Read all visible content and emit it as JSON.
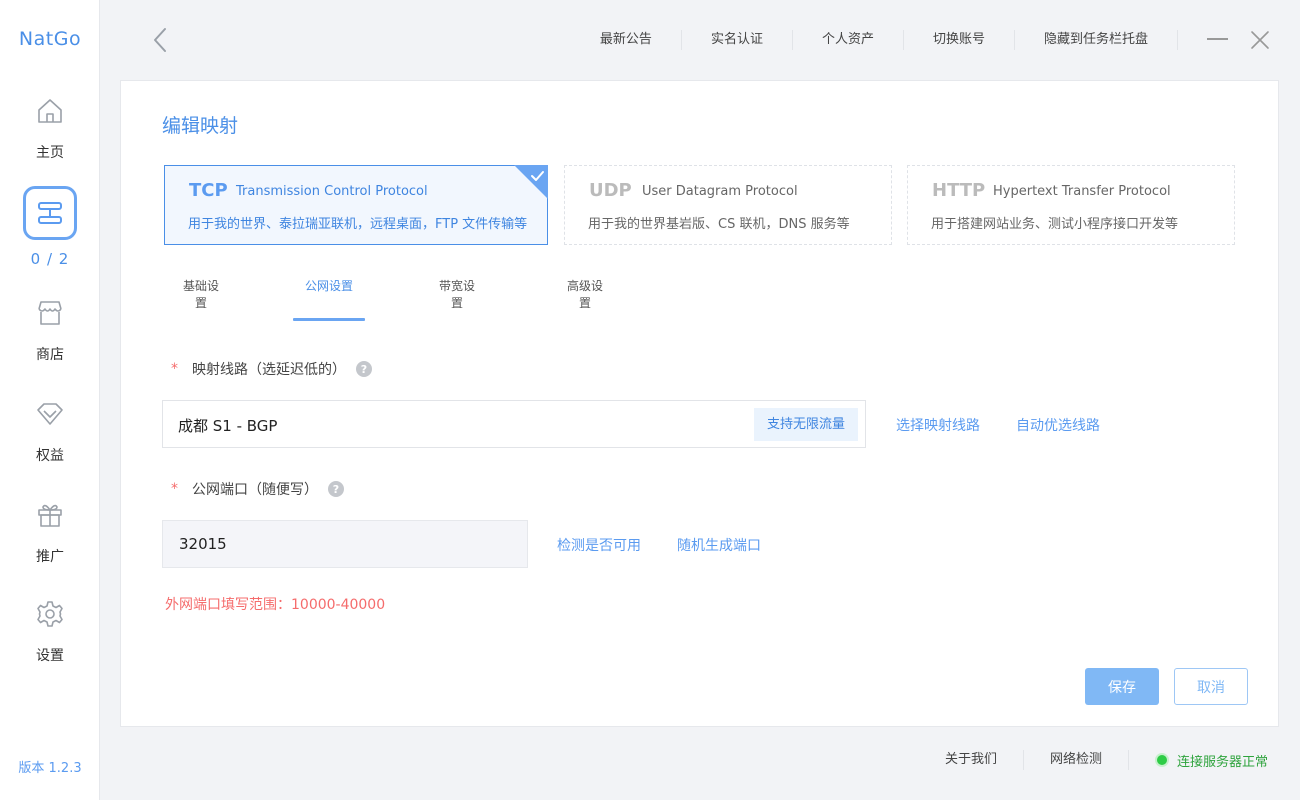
{
  "app": {
    "brand": "NatGo",
    "version": "版本 1.2.3"
  },
  "sidebar": {
    "items": [
      {
        "label": "主页",
        "icon": "home-icon"
      },
      {
        "label": "0 / 2",
        "icon": "mapping-icon",
        "active": true
      },
      {
        "label": "商店",
        "icon": "store-icon"
      },
      {
        "label": "权益",
        "icon": "diamond-icon"
      },
      {
        "label": "推广",
        "icon": "gift-icon"
      },
      {
        "label": "设置",
        "icon": "gear-icon"
      }
    ]
  },
  "topnav": {
    "items": [
      "最新公告",
      "实名认证",
      "个人资产",
      "切换账号",
      "隐藏到任务栏托盘"
    ]
  },
  "page": {
    "title": "编辑映射"
  },
  "protocols": [
    {
      "name": "TCP",
      "full": "Transmission Control Protocol",
      "desc": "用于我的世界、泰拉瑞亚联机，远程桌面，FTP 文件传输等",
      "selected": true
    },
    {
      "name": "UDP",
      "full": "User Datagram Protocol",
      "desc": "用于我的世界基岩版、CS 联机，DNS 服务等",
      "selected": false
    },
    {
      "name": "HTTP",
      "full": "Hypertext Transfer Protocol",
      "desc": "用于搭建网站业务、测试小程序接口开发等",
      "selected": false
    }
  ],
  "tabs": [
    {
      "label": "基础设置"
    },
    {
      "label": "公网设置",
      "active": true
    },
    {
      "label": "带宽设置"
    },
    {
      "label": "高级设置"
    }
  ],
  "route": {
    "required_mark": "*",
    "label": "映射线路（选延迟低的）",
    "help": "?",
    "value": "成都 S1 - BGP",
    "tag": "支持无限流量",
    "select_link": "选择映射线路",
    "auto_link": "自动优选线路"
  },
  "port": {
    "required_mark": "*",
    "label": "公网端口（随便写）",
    "help": "?",
    "value": "32015",
    "check_link": "检测是否可用",
    "random_link": "随机生成端口",
    "range_hint": "外网端口填写范围：10000-40000"
  },
  "actions": {
    "save": "保存",
    "cancel": "取消"
  },
  "footer": {
    "about": "关于我们",
    "network_check": "网络检测",
    "status": "连接服务器正常",
    "status_color": "#2ecc46"
  },
  "colors": {
    "accent": "#4a8fe7",
    "error": "#f56c6c",
    "success": "#2fa33d"
  }
}
